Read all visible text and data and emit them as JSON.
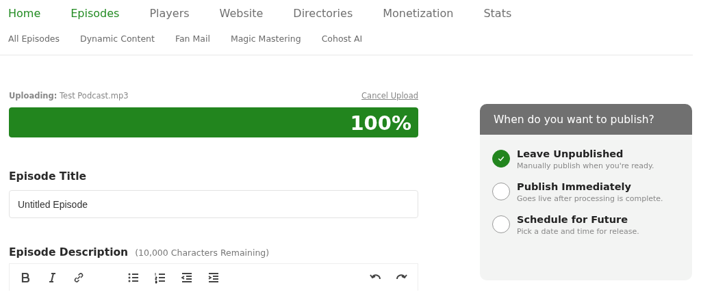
{
  "main_nav": [
    {
      "label": "Home",
      "selected": true
    },
    {
      "label": "Episodes",
      "selected": true
    },
    {
      "label": "Players",
      "selected": false
    },
    {
      "label": "Website",
      "selected": false
    },
    {
      "label": "Directories",
      "selected": false
    },
    {
      "label": "Monetization",
      "selected": false
    },
    {
      "label": "Stats",
      "selected": false
    }
  ],
  "sub_nav": [
    {
      "label": "All Episodes"
    },
    {
      "label": "Dynamic Content"
    },
    {
      "label": "Fan Mail"
    },
    {
      "label": "Magic Mastering"
    },
    {
      "label": "Cohost AI"
    }
  ],
  "upload": {
    "label": "Uploading:",
    "file": "Test Podcast.mp3",
    "cancel": "Cancel Upload",
    "level": 1,
    "percent": "100%"
  },
  "title_field": {
    "label": "Episode Title",
    "value": "Untitled Episode"
  },
  "description": {
    "label": "Episode Description",
    "remaining": "(10,000 Characters Remaining)",
    "toolbar": [
      {
        "kind": "bold"
      },
      {
        "kind": "italic"
      },
      {
        "kind": "link"
      },
      {
        "kind": "bullets"
      },
      {
        "kind": "numbered"
      },
      {
        "kind": "outdent"
      },
      {
        "kind": "indent"
      },
      {
        "kind": "undo"
      },
      {
        "kind": "redo"
      }
    ]
  },
  "publish_panel": {
    "title": "When do you want to publish?",
    "options": [
      {
        "label": "Leave Unpublished",
        "hint": "Manually publish when you're ready.",
        "selected": true
      },
      {
        "label": "Publish Immediately",
        "hint": "Goes live after processing is complete.",
        "selected": false
      },
      {
        "label": "Schedule for Future",
        "hint": "Pick a date and time for release.",
        "selected": false
      }
    ]
  }
}
